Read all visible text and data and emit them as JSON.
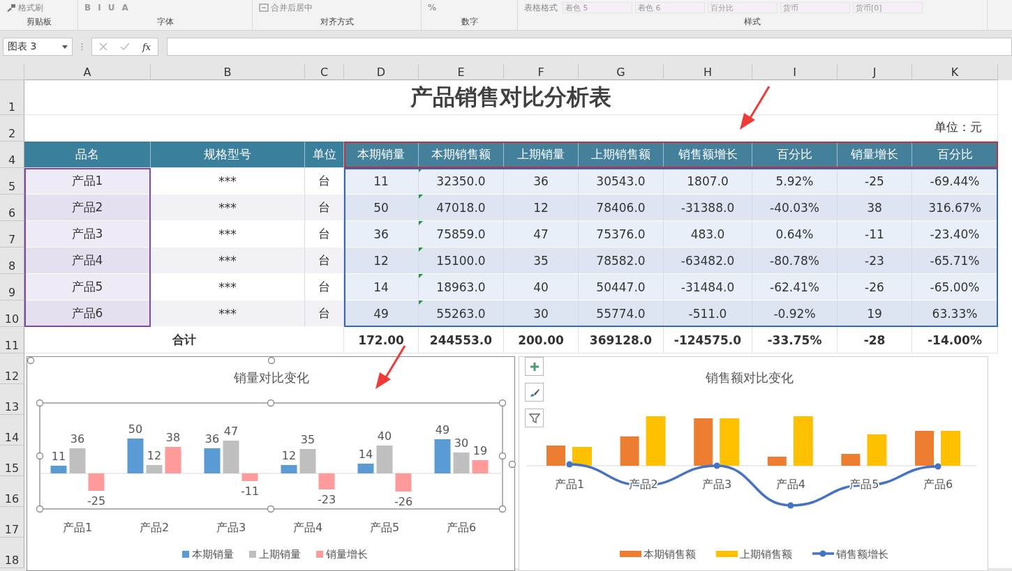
{
  "ribbon": {
    "groups": [
      {
        "label": "剪贴板",
        "items": [
          {
            "kind": "brush",
            "text": "格式刷"
          }
        ]
      },
      {
        "label": "字体",
        "items": [
          {
            "kind": "glyph",
            "text": "B"
          },
          {
            "kind": "glyph",
            "text": "I"
          },
          {
            "kind": "glyph",
            "text": "U"
          },
          {
            "kind": "glyph",
            "text": "A"
          }
        ]
      },
      {
        "label": "对齐方式",
        "items": [
          {
            "kind": "merge",
            "text": "合并后居中"
          }
        ]
      },
      {
        "label": "数字",
        "items": [
          {
            "kind": "glyph",
            "text": "%"
          }
        ]
      },
      {
        "label": "样式",
        "items": [
          {
            "kind": "plain",
            "text": "表格格式"
          },
          {
            "kind": "style",
            "text": "着色 5"
          },
          {
            "kind": "style",
            "text": "着色 6"
          },
          {
            "kind": "style",
            "text": "百分比"
          },
          {
            "kind": "style",
            "text": "货币"
          },
          {
            "kind": "style",
            "text": "货币[0]"
          }
        ]
      }
    ]
  },
  "name_box": "图表 3",
  "formula_bar": {
    "fx": "fx"
  },
  "columns": [
    "A",
    "B",
    "C",
    "D",
    "E",
    "F",
    "G",
    "H",
    "I",
    "J",
    "K"
  ],
  "sheet": {
    "title": "产品销售对比分析表",
    "unit": "单位：元",
    "header": [
      "品名",
      "规格型号",
      "单位",
      "本期销量",
      "本期销售额",
      "上期销量",
      "上期销售额",
      "销售额增长",
      "百分比",
      "销量增长",
      "百分比"
    ],
    "rows": [
      {
        "number": "5",
        "flagged": true,
        "cells": [
          "产品1",
          "***",
          "台",
          "11",
          "32350.0",
          "36",
          "30543.0",
          "1807.0",
          "5.92%",
          "-25",
          "-69.44%"
        ]
      },
      {
        "number": "6",
        "flagged": true,
        "cells": [
          "产品2",
          "***",
          "台",
          "50",
          "47018.0",
          "12",
          "78406.0",
          "-31388.0",
          "-40.03%",
          "38",
          "316.67%"
        ]
      },
      {
        "number": "7",
        "flagged": true,
        "cells": [
          "产品3",
          "***",
          "台",
          "36",
          "75859.0",
          "47",
          "75376.0",
          "483.0",
          "0.64%",
          "-11",
          "-23.40%"
        ]
      },
      {
        "number": "8",
        "flagged": true,
        "cells": [
          "产品4",
          "***",
          "台",
          "12",
          "15100.0",
          "35",
          "78582.0",
          "-63482.0",
          "-80.78%",
          "-23",
          "-65.71%"
        ]
      },
      {
        "number": "9",
        "flagged": true,
        "cells": [
          "产品5",
          "***",
          "台",
          "14",
          "18963.0",
          "40",
          "50447.0",
          "-31484.0",
          "-62.41%",
          "-26",
          "-65.00%"
        ]
      },
      {
        "number": "10",
        "flagged": true,
        "cells": [
          "产品6",
          "***",
          "台",
          "49",
          "55263.0",
          "30",
          "55774.0",
          "-511.0",
          "-0.92%",
          "19",
          "63.33%"
        ]
      }
    ],
    "total": {
      "label": "合计",
      "values": [
        "172.00",
        "244553.0",
        "200.00",
        "369128.0",
        "-124575.0",
        "-33.75%",
        "-28",
        "-14.00%"
      ]
    },
    "row_numbers": {
      "title": "1",
      "unit": "2",
      "header": "4",
      "total": "11",
      "below": [
        "12",
        "13",
        "14",
        "15",
        "16",
        "17",
        "18"
      ]
    }
  },
  "chart1": {
    "chart_data": {
      "type": "bar",
      "title": "销量对比变化",
      "categories": [
        "产品1",
        "产品2",
        "产品3",
        "产品4",
        "产品5",
        "产品6"
      ],
      "data_labels": true,
      "legend": "bottom",
      "series": [
        {
          "name": "本期销量",
          "color": "#5b9bd5",
          "values": [
            11,
            50,
            36,
            12,
            14,
            49
          ]
        },
        {
          "name": "上期销量",
          "color": "#bfbfbf",
          "values": [
            36,
            12,
            47,
            35,
            40,
            30
          ]
        },
        {
          "name": "销量增长",
          "color": "#ff9b9b",
          "values": [
            -25,
            38,
            -11,
            -23,
            -26,
            19
          ]
        }
      ]
    }
  },
  "chart2": {
    "title": "销售额对比变化",
    "categories": [
      "产品1",
      "产品2",
      "产品3",
      "产品4",
      "产品5",
      "产品6"
    ],
    "legend": [
      {
        "kind": "bar",
        "name": "本期销售额",
        "color": "#ed7d31"
      },
      {
        "kind": "bar",
        "name": "上期销售额",
        "color": "#ffc000"
      },
      {
        "kind": "line",
        "name": "销售额增长",
        "color": "#4472c4"
      }
    ]
  }
}
